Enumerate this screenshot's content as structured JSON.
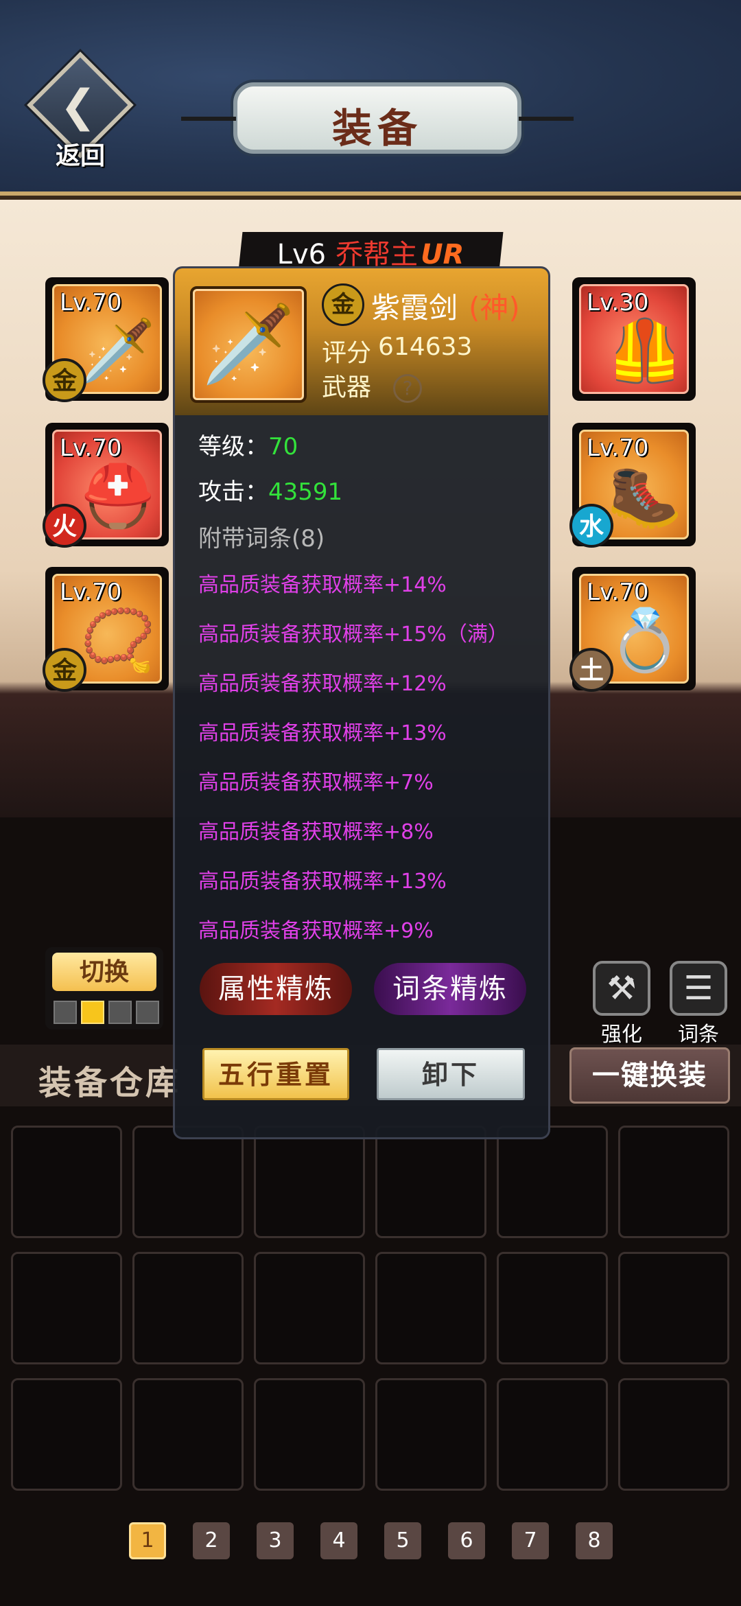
{
  "header": {
    "title": "装备",
    "back_label": "返回"
  },
  "character": {
    "level": "Lv6",
    "name": "乔帮主",
    "rarity": "UR"
  },
  "slots_left": [
    {
      "level": "Lv.70",
      "element": "金",
      "gear_icon": "sword-icon"
    },
    {
      "level": "Lv.70",
      "element": "火",
      "gear_icon": "helmet-icon"
    },
    {
      "level": "Lv.70",
      "element": "金",
      "gear_icon": "necklace-icon"
    }
  ],
  "slots_right": [
    {
      "level": "Lv.30",
      "element": "",
      "gear_icon": "armor-icon"
    },
    {
      "level": "Lv.70",
      "element": "水",
      "gear_icon": "boots-icon"
    },
    {
      "level": "Lv.70",
      "element": "土",
      "gear_icon": "ring-icon"
    }
  ],
  "popup": {
    "element": "金",
    "item_name": "紫霞剑",
    "grade": "(神)",
    "score_label": "评分",
    "score": "614633",
    "item_type": "武器",
    "help": "?",
    "level_label": "等级：",
    "level_value": "70",
    "attack_label": "攻击：",
    "attack_value": "43591",
    "affix_header": "附带词条(8)",
    "affixes": [
      "高品质装备获取概率+14%",
      "高品质装备获取概率+15%（满）",
      "高品质装备获取概率+12%",
      "高品质装备获取概率+13%",
      "高品质装备获取概率+7%",
      "高品质装备获取概率+8%",
      "高品质装备获取概率+13%",
      "高品质装备获取概率+9%"
    ],
    "refine_attr": "属性精炼",
    "refine_affix": "词条精炼",
    "reset_button": "五行重置",
    "unequip_button": "卸下"
  },
  "bottom": {
    "switch_label": "切换",
    "switch_pages_active": 2,
    "strengthen_label": "强化",
    "affix_label": "词条",
    "warehouse_label": "装备仓库",
    "equip_all_label": "一键换装",
    "pages": [
      "1",
      "2",
      "3",
      "4",
      "5",
      "6",
      "7",
      "8"
    ],
    "active_page": "1"
  },
  "colors": {
    "affix": "#e040e8",
    "stat_value": "#33e23b",
    "grade": "#ff5a2a",
    "header_bg": "#24344f"
  }
}
